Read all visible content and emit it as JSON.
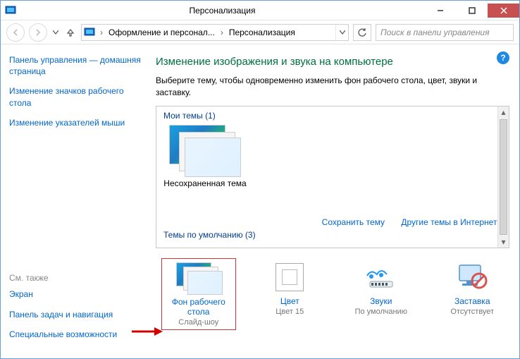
{
  "title": "Персонализация",
  "breadcrumb": {
    "seg1": "Оформление и персонал...",
    "seg2": "Персонализация"
  },
  "search": {
    "placeholder": "Поиск в панели управления"
  },
  "sidebar": {
    "items": [
      "Панель управления — домашняя страница",
      "Изменение значков рабочего стола",
      "Изменение указателей мыши"
    ],
    "see_also_head": "См. также",
    "see_also": [
      "Экран",
      "Панель задач и навигация",
      "Специальные возможности"
    ]
  },
  "main": {
    "heading": "Изменение изображения и звука на компьютере",
    "subtitle": "Выберите тему, чтобы одновременно изменить фон рабочего стола, цвет, звуки и заставку.",
    "my_themes_label": "Мои темы (1)",
    "unsaved_theme": "Несохраненная тема",
    "save_theme": "Сохранить тему",
    "other_themes": "Другие темы в Интернете",
    "default_themes_label": "Темы по умолчанию (3)"
  },
  "options": {
    "bg": {
      "label": "Фон рабочего стола",
      "sub": "Слайд-шоу"
    },
    "color": {
      "label": "Цвет",
      "sub": "Цвет 15"
    },
    "sounds": {
      "label": "Звуки",
      "sub": "По умолчанию"
    },
    "saver": {
      "label": "Заставка",
      "sub": "Отсутствует"
    }
  }
}
